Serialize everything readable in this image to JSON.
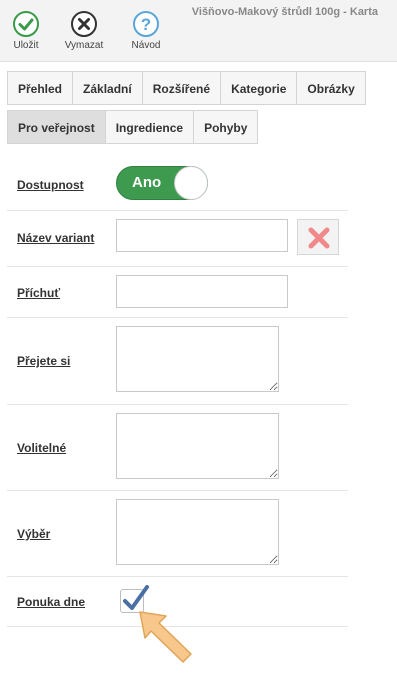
{
  "window": {
    "title": "Višňovo-Makový štrůdl 100g - Karta"
  },
  "toolbar": {
    "save_label": "Uložit",
    "delete_label": "Vymazat",
    "help_label": "Návod"
  },
  "tabs_row1": [
    "Přehled",
    "Základní",
    "Rozšířené",
    "Kategorie",
    "Obrázky"
  ],
  "tabs_row2": [
    "Pro veřejnost",
    "Ingredience",
    "Pohyby"
  ],
  "active_tab": "Pro veřejnost",
  "form": {
    "availability": {
      "label": "Dostupnost",
      "toggle_text": "Ano"
    },
    "variant_name": {
      "label": "Název variant",
      "value": ""
    },
    "flavor": {
      "label": "Příchuť",
      "value": ""
    },
    "wish": {
      "label": "Přejete si",
      "value": ""
    },
    "optional": {
      "label": "Volitelné",
      "value": ""
    },
    "choice": {
      "label": "Výběr",
      "value": ""
    },
    "daily_offer": {
      "label": "Ponuka dne",
      "checked": true
    }
  },
  "colors": {
    "toggle_on": "#3d9a4f",
    "delete_x": "#f08a8a",
    "check_mark": "#4a6fa5",
    "arrow_fill": "#f8c78c",
    "save_icon": "#3a9a4a",
    "help_icon": "#5aa6d8"
  },
  "icons": {
    "save": "check-circle-icon",
    "delete": "x-circle-icon",
    "help": "question-circle-icon",
    "remove_variant": "red-x-icon",
    "pointer": "arrow-pointer-icon"
  }
}
